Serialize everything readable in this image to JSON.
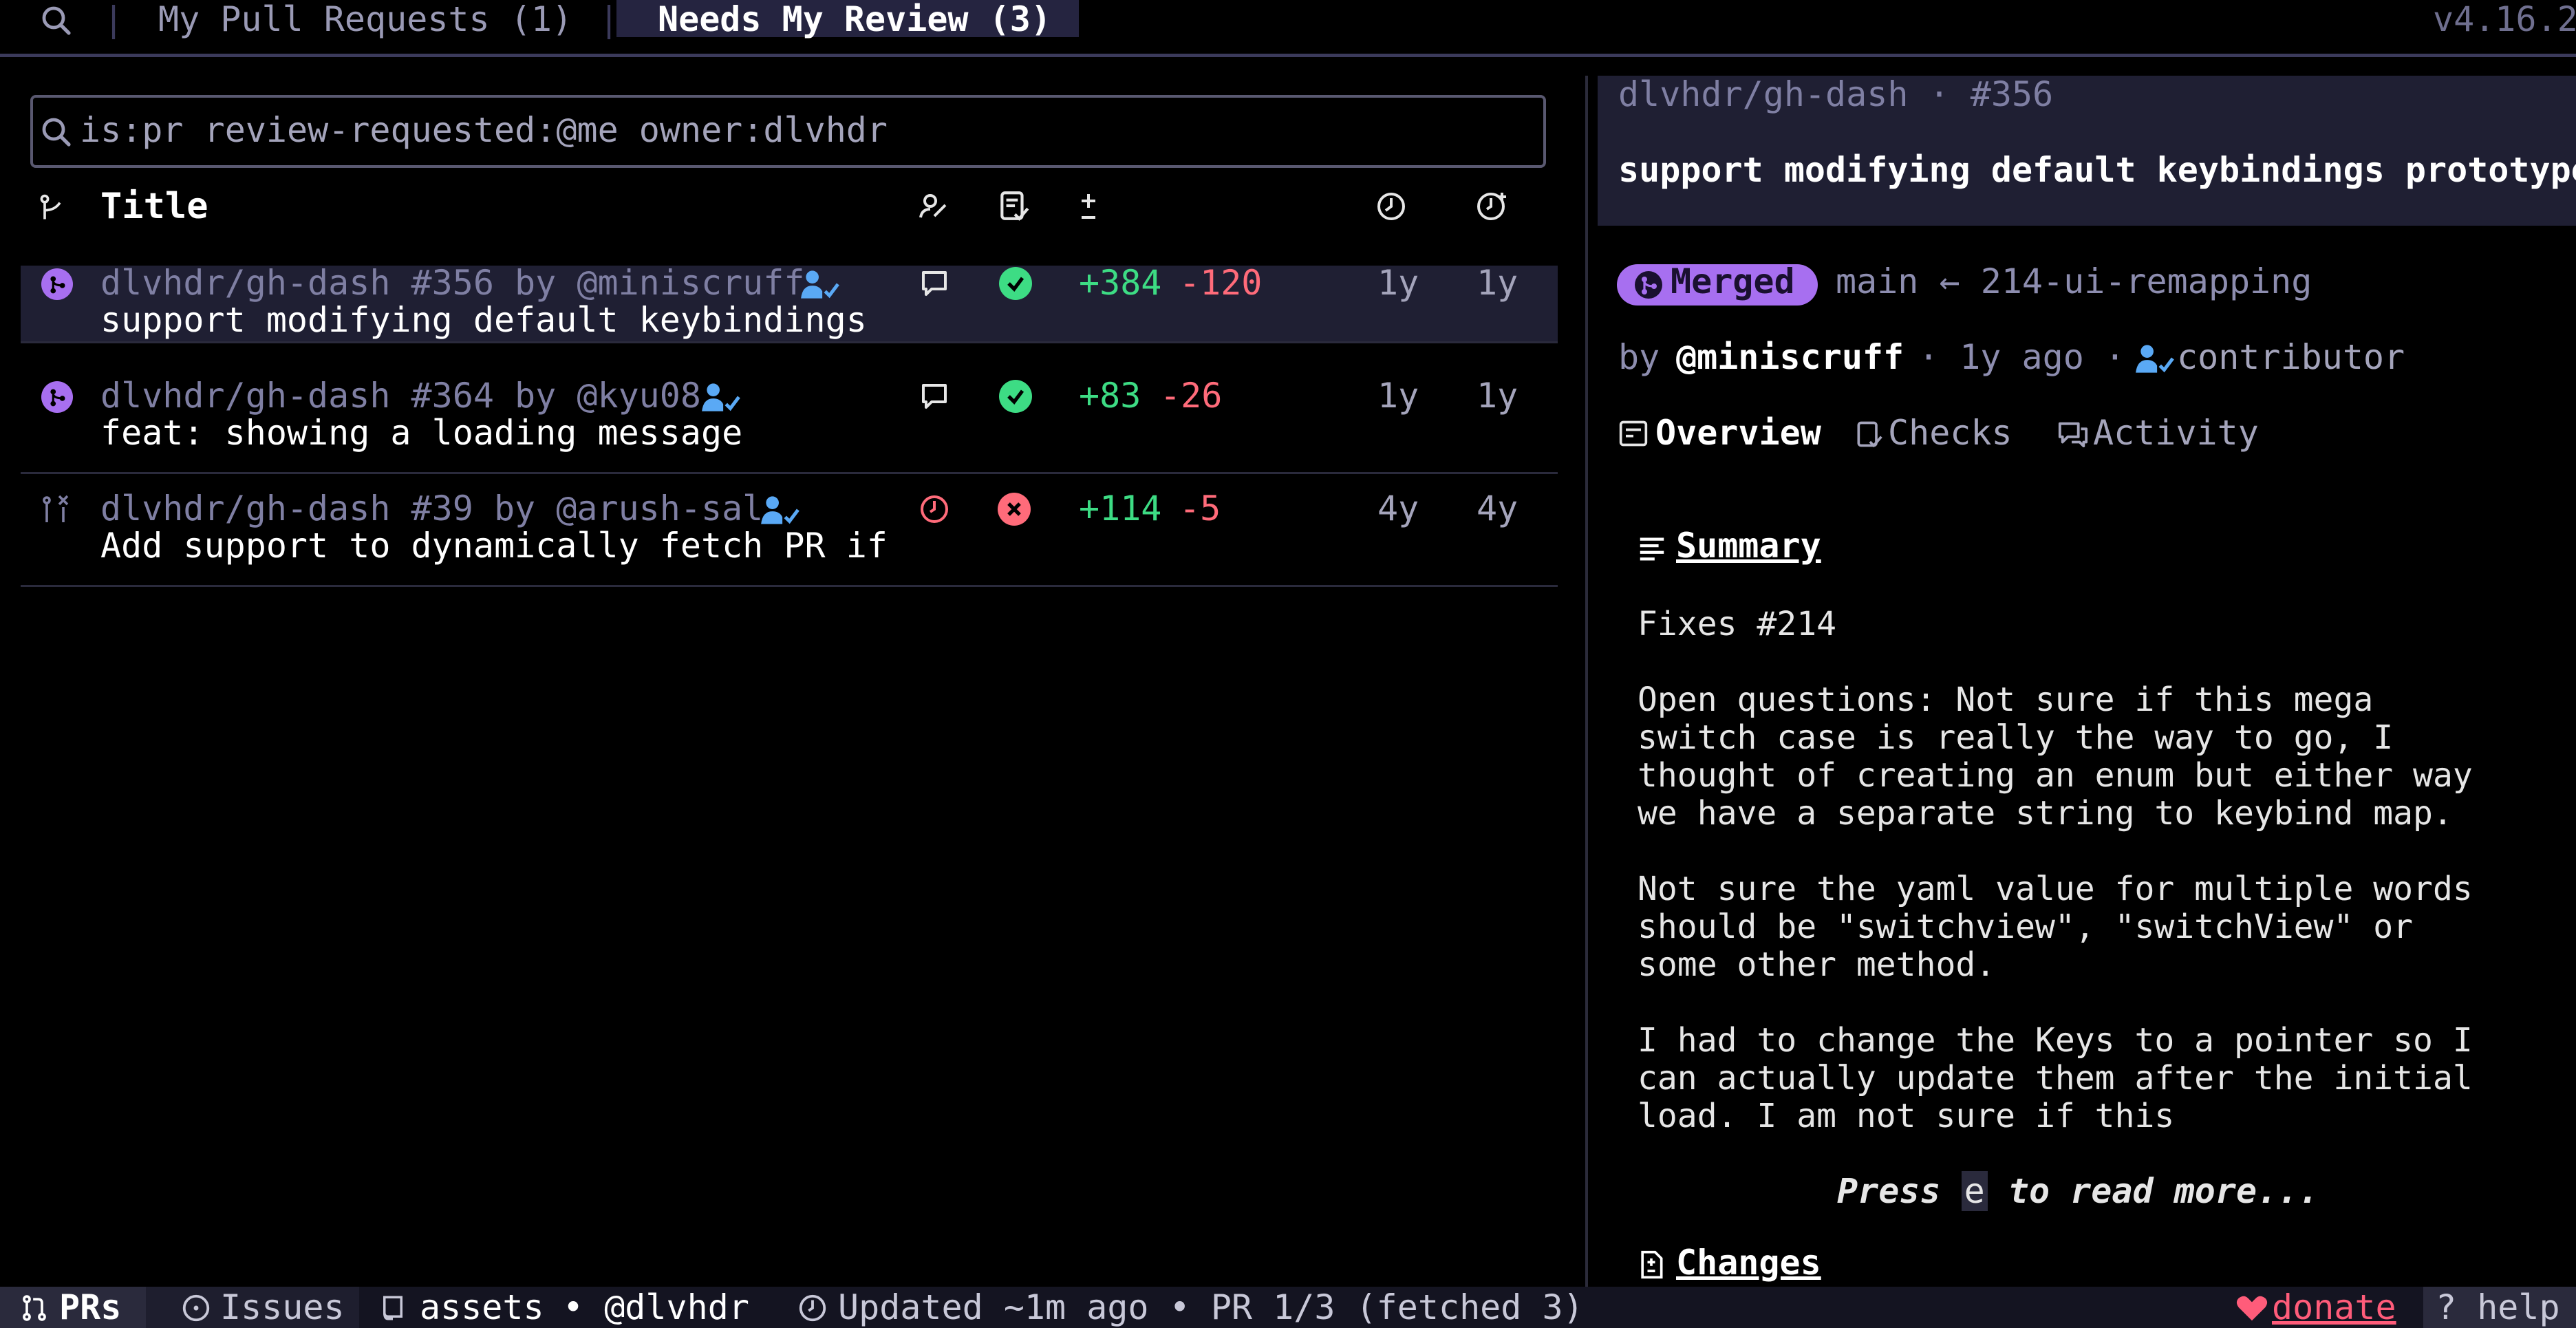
{
  "tabs": {
    "my_prs": "My Pull Requests (1)",
    "needs_review": "Needs My Review (3)",
    "version": "v4.16.2"
  },
  "search": {
    "query": "is:pr review-requested:@me owner:dlvhdr"
  },
  "table": {
    "header_title": "Title",
    "rows": [
      {
        "repo_line": "dlvhdr/gh-dash #356 by @miniscruff",
        "title": "support modifying default keybindings",
        "additions": "+384",
        "deletions": "-120",
        "updated": "1y",
        "created": "1y",
        "state": "merged",
        "checks": "success"
      },
      {
        "repo_line": "dlvhdr/gh-dash #364 by @kyu08",
        "title": "feat: showing a loading message",
        "additions": "+83",
        "deletions": "-26",
        "updated": "1y",
        "created": "1y",
        "state": "merged",
        "checks": "success"
      },
      {
        "repo_line": "dlvhdr/gh-dash #39 by @arush-sal",
        "title": "Add support to dynamically fetch PR if",
        "additions": "+114",
        "deletions": "-5",
        "updated": "4y",
        "created": "4y",
        "state": "closed",
        "checks": "failure"
      }
    ]
  },
  "preview": {
    "repo_ref": "dlvhdr/gh-dash · #356",
    "title": "support modifying default keybindings prototype",
    "status_badge": "Merged",
    "branch_info": "main ← 214-ui-remapping",
    "by_label": "by",
    "author": "@miniscruff",
    "time_ago": "· 1y ago ·",
    "role": "contributor",
    "tab_overview": "Overview",
    "tab_checks": "Checks",
    "tab_activity": "Activity",
    "summary_heading": "Summary",
    "body_lines": [
      "Fixes #214",
      "",
      "Open questions: Not sure if this mega",
      "switch case is really the way to go, I",
      "thought of creating an enum but either way",
      "we have a separate string to keybind map.",
      "",
      "Not sure the yaml value for multiple words",
      "should be \"switchview\", \"switchView\" or",
      "some other method.",
      "",
      "I had to change the Keys to a pointer so I",
      "can actually update them after the initial",
      "load. I am not sure if this"
    ],
    "press_prefix": "Press",
    "press_key": "e",
    "press_suffix": "to read more...",
    "changes_heading": "Changes"
  },
  "statusbar": {
    "prs": "PRs",
    "issues": "Issues",
    "repo": "assets",
    "user": "• @dlvhdr",
    "updated": "Updated ~1m ago • PR 1/3 (fetched 3)",
    "donate": "donate",
    "help": "? help"
  },
  "colors": {
    "background": "#000000",
    "active_tab": "#252440",
    "selected_row": "#1f1f33",
    "merged": "#a76ff0",
    "success": "#3ddc84",
    "failure": "#ff6b7a",
    "accent_blue": "#5aa9f5"
  },
  "icons": [
    "search-icon",
    "branch-icon",
    "review-icon",
    "checks-icon",
    "plus-minus-icon",
    "clock-icon",
    "clock-plus-icon",
    "merge-icon",
    "comment-icon",
    "check-circle-icon",
    "x-circle-icon",
    "person-check-icon",
    "closed-pr-icon",
    "pending-clock-icon",
    "overview-icon",
    "activity-icon",
    "summary-icon",
    "changes-icon",
    "pr-icon",
    "issue-icon",
    "repo-icon",
    "heart-icon"
  ]
}
